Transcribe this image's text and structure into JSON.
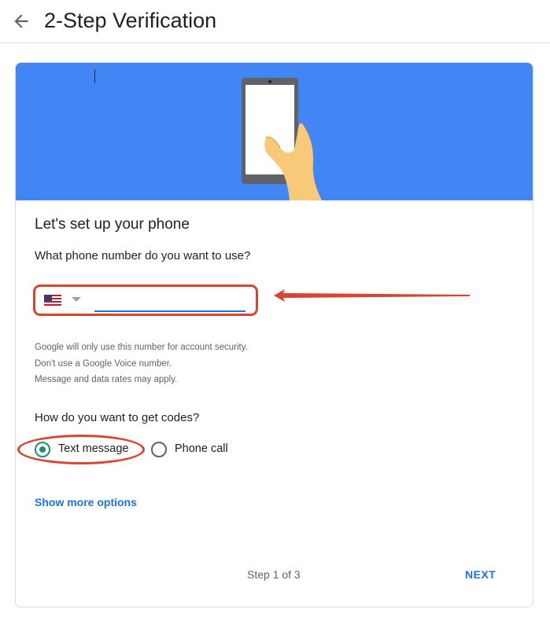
{
  "header": {
    "title": "2-Step Verification",
    "back_icon": "arrow-left-icon"
  },
  "colors": {
    "banner": "#4285f4",
    "accent": "#1a73e8",
    "radio_checked": "#1e8e70",
    "annotation": "#d9442f"
  },
  "setup": {
    "heading": "Let's set up your phone",
    "phone_question": "What phone number do you want to use?",
    "country_icon": "us-flag-icon",
    "phone_value": ""
  },
  "help": [
    "Google will only use this number for account security.",
    "Don't use a Google Voice number.",
    "Message and data rates may apply."
  ],
  "codes": {
    "question": "How do you want to get codes?",
    "options": [
      {
        "label": "Text message",
        "selected": true
      },
      {
        "label": "Phone call",
        "selected": false
      }
    ]
  },
  "footer": {
    "more_options": "Show more options",
    "step": "Step 1 of 3",
    "next": "NEXT"
  }
}
